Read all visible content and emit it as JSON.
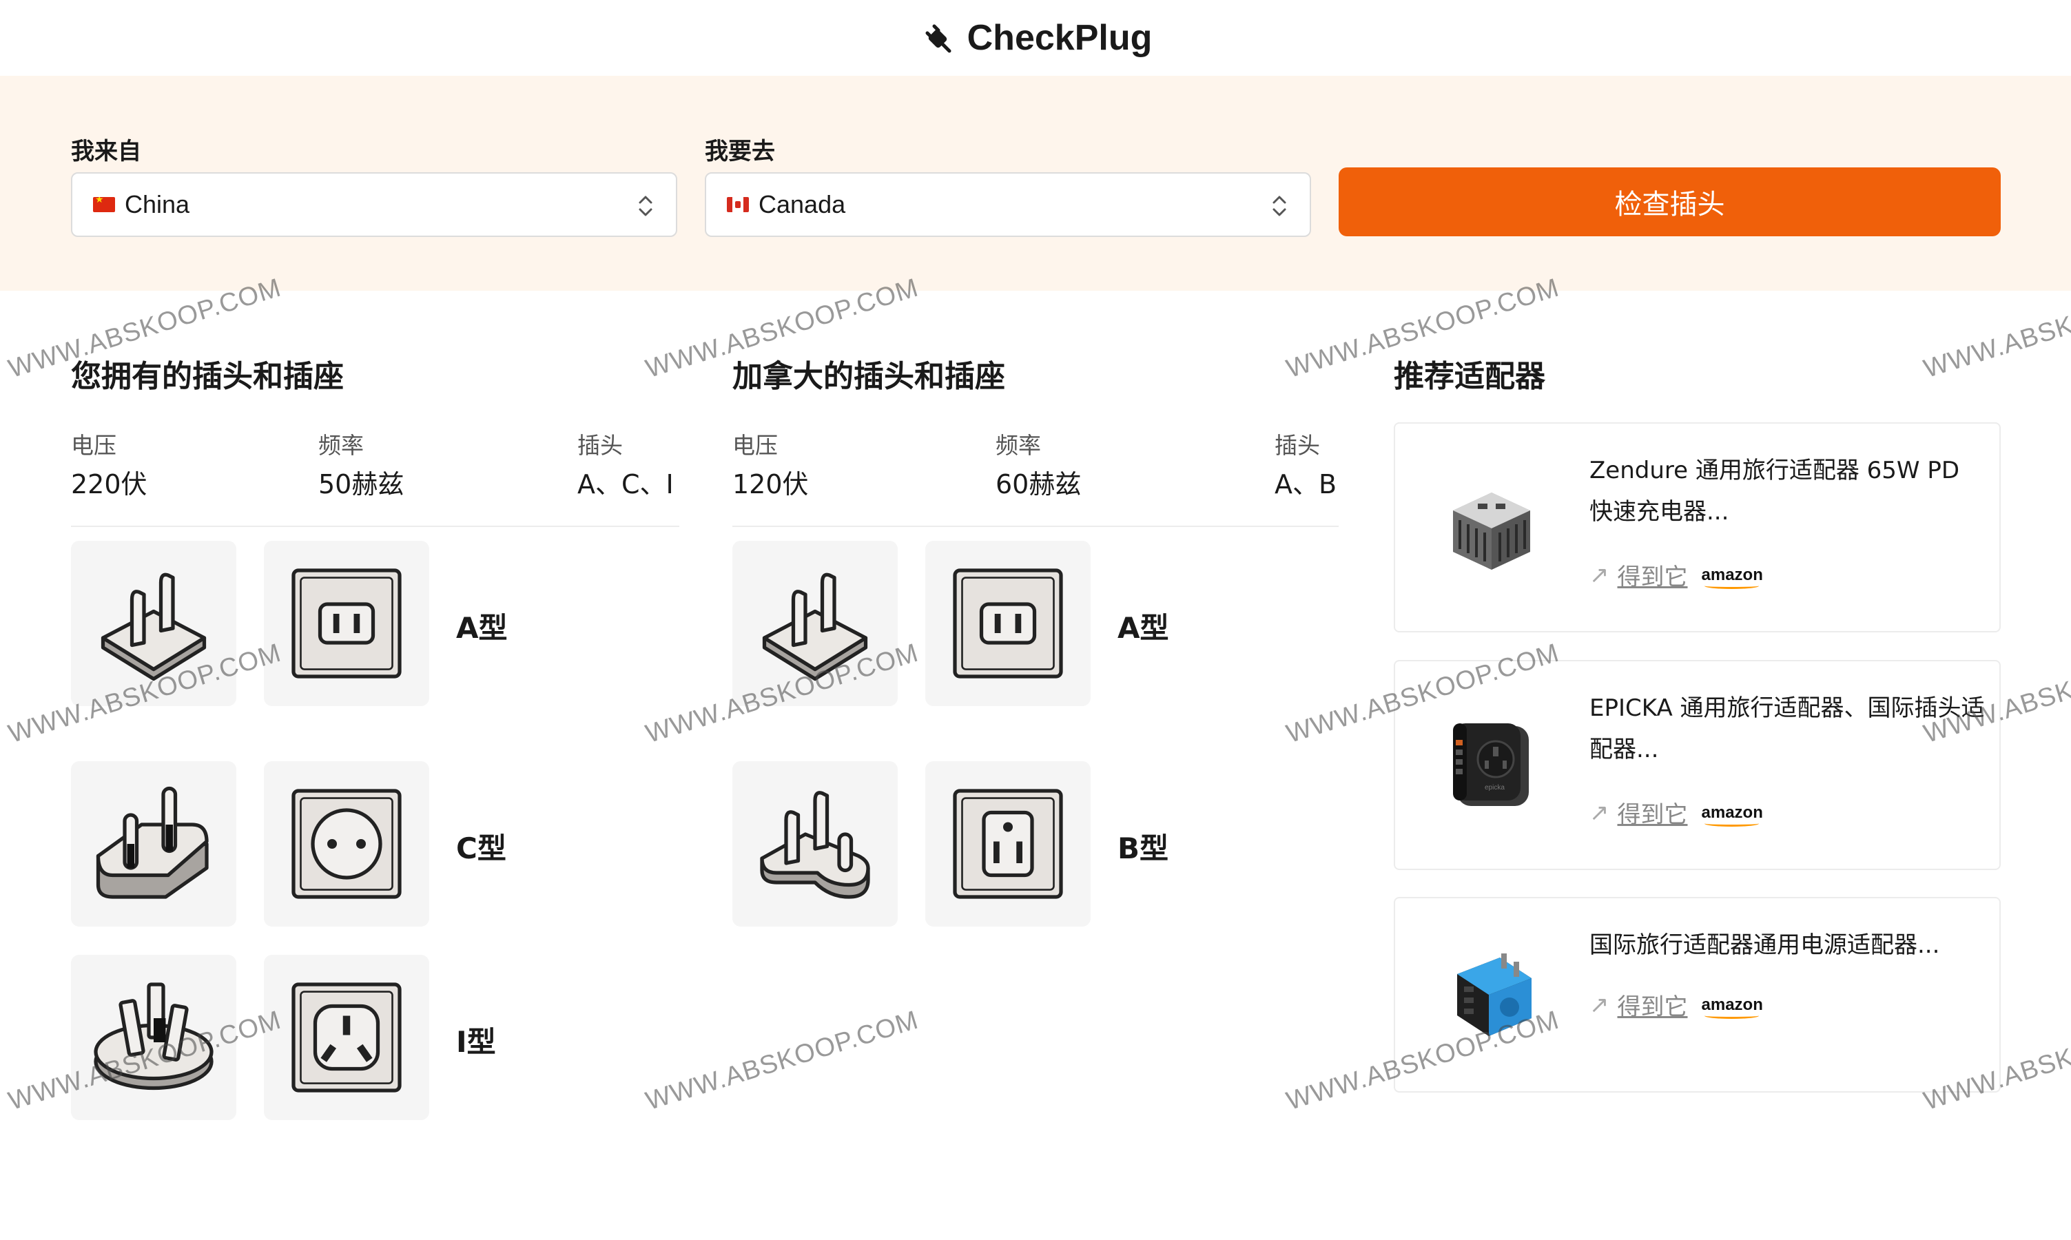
{
  "header": {
    "logo_text": "CheckPlug"
  },
  "search": {
    "from_label": "我来自",
    "from_value": "China",
    "to_label": "我要去",
    "to_value": "Canada",
    "check_button": "检查插头"
  },
  "origin": {
    "title": "您拥有的插头和插座",
    "voltage_label": "电压",
    "voltage_value": "220伏",
    "frequency_label": "频率",
    "frequency_value": "50赫兹",
    "plugs_label": "插头",
    "plugs_value": "A、C、I",
    "types": [
      {
        "label": "A型",
        "icon": "plug-type-a-icon"
      },
      {
        "label": "C型",
        "icon": "plug-type-c-icon"
      },
      {
        "label": "I型",
        "icon": "plug-type-i-icon"
      }
    ]
  },
  "destination": {
    "title": "加拿大的插头和插座",
    "voltage_label": "电压",
    "voltage_value": "120伏",
    "frequency_label": "频率",
    "frequency_value": "60赫兹",
    "plugs_label": "插头",
    "plugs_value": "A、B",
    "types": [
      {
        "label": "A型",
        "icon": "plug-type-a-icon"
      },
      {
        "label": "B型",
        "icon": "plug-type-b-icon"
      }
    ]
  },
  "recommend": {
    "title": "推荐适配器",
    "buy_label": "得到它",
    "store": "amazon",
    "products": [
      {
        "name": "Zendure 通用旅行适配器 65W PD 快速充电器..."
      },
      {
        "name": "EPICKA 通用旅行适配器、国际插头适配器..."
      },
      {
        "name": "国际旅行适配器通用电源适配器..."
      }
    ]
  },
  "watermark": "WWW.ABSKOOP.COM",
  "colors": {
    "accent": "#f0600a",
    "band": "#fef5ec",
    "tile": "#f5f5f5"
  }
}
